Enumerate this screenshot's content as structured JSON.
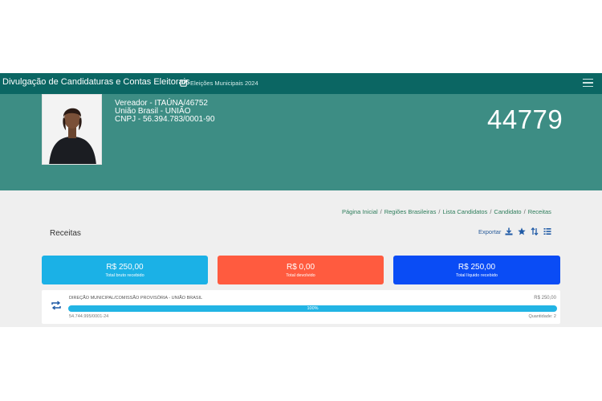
{
  "nav": {
    "title": "Divulgação de Candidaturas e Contas Eleitorais",
    "subtitle": "Eleições Municipais 2024"
  },
  "candidate": {
    "line1": "Vereador - ITAÚNA/46752",
    "line2": "União Brasil - UNIÃO",
    "line3": "CNPJ - 56.394.783/0001-90",
    "number": "44779"
  },
  "breadcrumb": [
    "Página Inicial",
    "Regiões Brasileiras",
    "Lista Candidatos",
    "Candidato",
    "Receitas"
  ],
  "page": {
    "title": "Receitas",
    "export_label": "Exportar"
  },
  "summary": {
    "gross": {
      "amount": "R$ 250,00",
      "caption": "Total bruto recebido",
      "color": "#1bb1e6"
    },
    "returned": {
      "amount": "R$ 0,00",
      "caption": "Total devolvido",
      "color": "#ff5b3f"
    },
    "net": {
      "amount": "R$ 250,00",
      "caption": "Total líquido recebido",
      "color": "#0a4cf5"
    }
  },
  "receipt": {
    "donor": "DIREÇÃO MUNICIPAL/COMISSÃO PROVISÓRIA - UNIÃO BRASIL",
    "value": "R$ 250,00",
    "progress_label": "100%",
    "progress": 1.0,
    "document": "54.744.995/0001-24",
    "quantity": "Quantidade: 2"
  },
  "colors": {
    "navbar": "#0b6663",
    "hero": "#3d8d84",
    "progress": "#22b4e4"
  }
}
